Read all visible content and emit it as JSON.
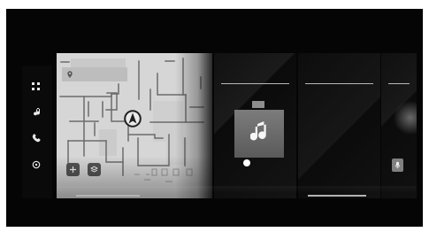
{
  "rail": {
    "items": [
      {
        "icon": "apps-icon"
      },
      {
        "icon": "music-icon"
      },
      {
        "icon": "phone-icon"
      },
      {
        "icon": "settings-icon"
      }
    ]
  },
  "map_panel": {
    "icons": [
      "pin-icon",
      "plus-icon",
      "layers-icon",
      "navigation-arrow-icon"
    ]
  },
  "music_panel": {
    "icons": [
      "music-note-icon"
    ]
  },
  "right_panel": {
    "icons": [
      "microphone-icon"
    ]
  }
}
